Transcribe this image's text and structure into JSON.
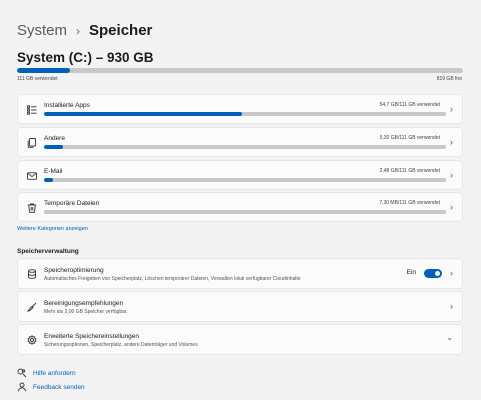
{
  "breadcrumb": {
    "parent": "System",
    "separator": "›",
    "current": "Speicher"
  },
  "drive": {
    "title": "System (C:) – 930 GB",
    "used_label": "111 GB verwendet",
    "free_label": "819 GB frei",
    "used_fraction": 0.119
  },
  "categories": [
    {
      "label": "Installierte Apps",
      "usage": "54,7 GB/111 GB verwendet",
      "fraction": 0.493,
      "icon": "apps-list-icon"
    },
    {
      "label": "Andere",
      "usage": "5,30 GB/111 GB verwendet",
      "fraction": 0.048,
      "icon": "documents-icon"
    },
    {
      "label": "E-Mail",
      "usage": "2,48 GB/111 GB verwendet",
      "fraction": 0.022,
      "icon": "mail-icon"
    },
    {
      "label": "Temporäre Dateien",
      "usage": "7,30 MB/111 GB verwendet",
      "fraction": 0.0,
      "icon": "trash-icon"
    }
  ],
  "more_categories_link": "Weitere Kategorien anzeigen",
  "management": {
    "title": "Speicherverwaltung",
    "items": [
      {
        "label": "Speicheroptimierung",
        "desc": "Automatisches Freigeben von Speicherplatz, Löschen temporärer Dateien, Verwalten lokal verfügbarer Cloudinhalte",
        "toggle_label": "Ein",
        "toggle_on": true,
        "icon": "storage-sense-icon"
      },
      {
        "label": "Bereinigungsempfehlungen",
        "desc": "Mehr als 2,00 GB Speicher verfügbar.",
        "icon": "broom-icon"
      },
      {
        "label": "Erweiterte Speichereinstellungen",
        "desc": "Sicherungsoptionen, Speicherplatz, andere Datenträger und Volumes",
        "icon": "gear-icon"
      }
    ]
  },
  "footer": {
    "help": "Hilfe anfordern",
    "feedback": "Feedback senden"
  },
  "colors": {
    "accent": "#005fb8",
    "track": "#c8c8c8"
  }
}
